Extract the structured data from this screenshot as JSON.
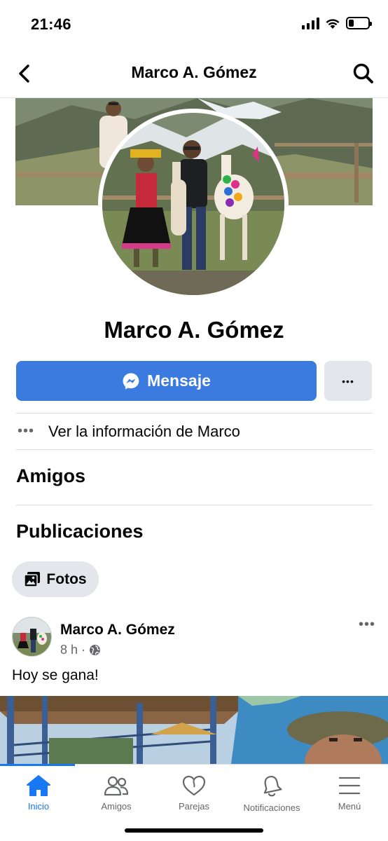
{
  "status_bar": {
    "time": "21:46",
    "icons": [
      "signal-icon",
      "wifi-icon",
      "battery-icon"
    ],
    "battery_level": 0.25
  },
  "header": {
    "title": "Marco A. Gómez",
    "back_icon": "chevron-left-icon",
    "search_icon": "search-icon"
  },
  "profile": {
    "name": "Marco A. Gómez",
    "message_label": "Mensaje",
    "message_icon": "messenger-icon",
    "more_label": "•••",
    "info_dots": "•••",
    "info_text": "Ver la información de Marco"
  },
  "sections": {
    "friends": "Amigos",
    "posts": "Publicaciones"
  },
  "filters": {
    "photos_label": "Fotos",
    "photos_icon": "photos-icon"
  },
  "post": {
    "author": "Marco A. Gómez",
    "time": "8 h",
    "separator": "·",
    "privacy_icon": "globe-icon",
    "more": "•••",
    "text": "Hoy se gana!"
  },
  "tabs": [
    {
      "label": "Inicio",
      "icon": "home-icon",
      "active": true
    },
    {
      "label": "Amigos",
      "icon": "friends-icon",
      "active": false
    },
    {
      "label": "Parejas",
      "icon": "heart-icon",
      "active": false
    },
    {
      "label": "Notificaciones",
      "icon": "bell-icon",
      "active": false
    },
    {
      "label": "Menú",
      "icon": "menu-icon",
      "active": false
    }
  ],
  "colors": {
    "accent": "#1877f2",
    "message_button": "#3b7be0",
    "secondary_button": "#e4e6eb",
    "muted_text": "#65676b"
  }
}
